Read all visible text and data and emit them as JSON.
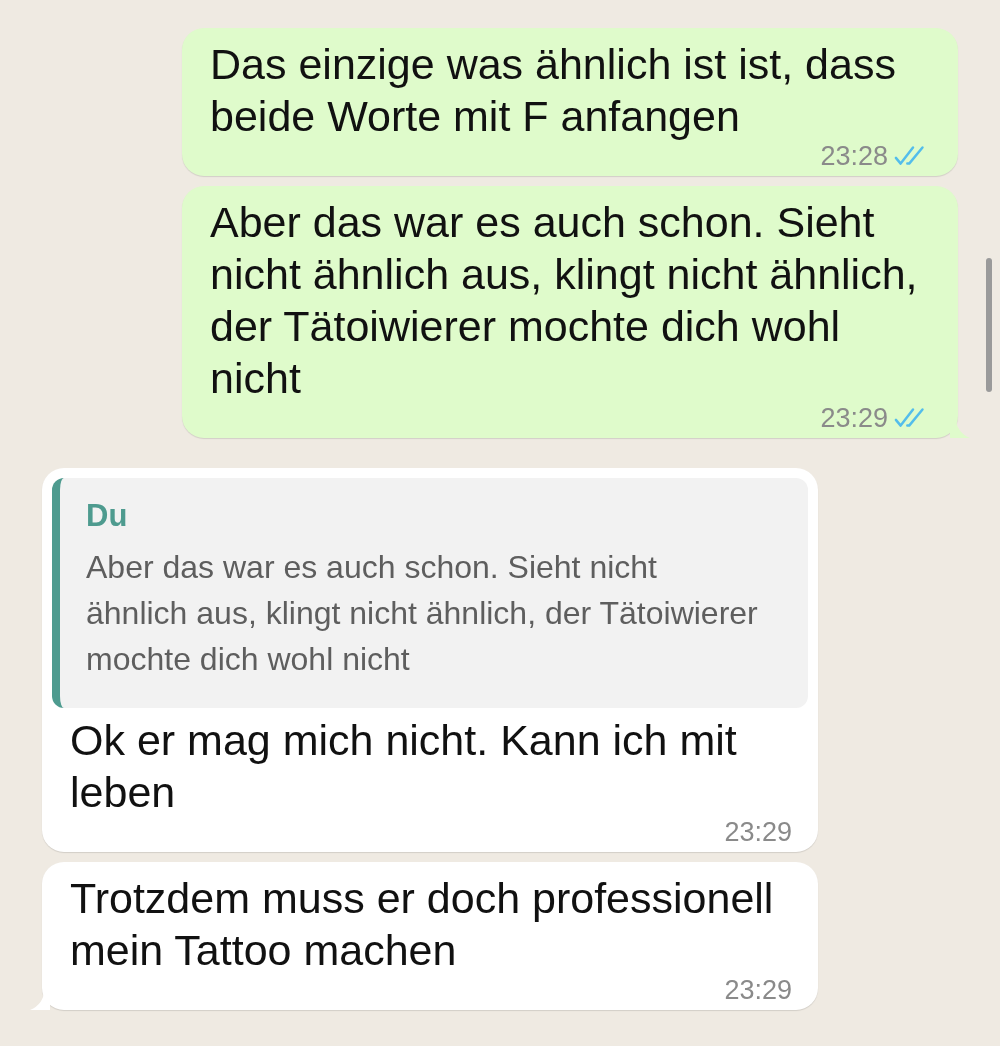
{
  "messages": [
    {
      "kind": "outgoing",
      "text": "Das einzige was ähnlich ist ist, dass beide Worte mit F anfangen",
      "time": "23:28",
      "read": true,
      "tail": false
    },
    {
      "kind": "outgoing",
      "text": "Aber das war es auch schon. Sieht nicht ähnlich aus, klingt nicht ähnlich, der Tätoiwierer mochte dich wohl nicht",
      "time": "23:29",
      "read": true,
      "tail": true
    },
    {
      "kind": "incoming",
      "quote": {
        "author": "Du",
        "text": "Aber das war es auch schon. Sieht nicht ähnlich aus, klingt nicht ähnlich, der Tätoiwierer mochte dich wohl nicht"
      },
      "text": "Ok er mag mich nicht. Kann ich mit leben",
      "time": "23:29",
      "tail": false
    },
    {
      "kind": "incoming",
      "text": "Trotzdem muss er doch professionell mein Tattoo machen",
      "time": "23:29",
      "tail": true
    }
  ]
}
